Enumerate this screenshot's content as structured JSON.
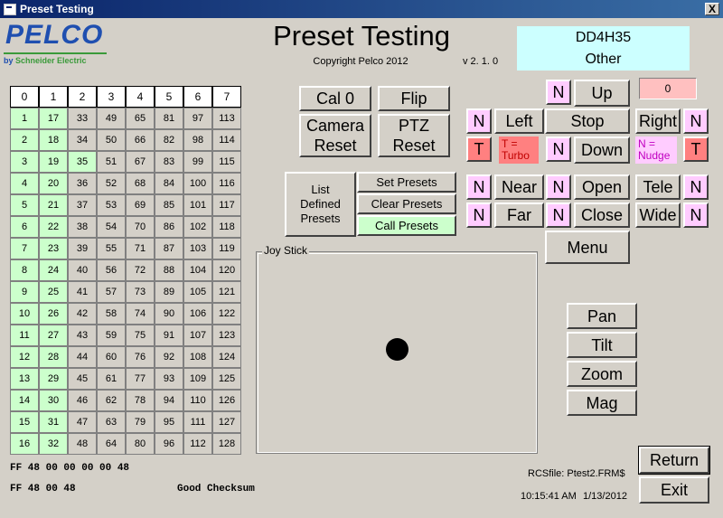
{
  "window": {
    "title": "Preset Testing",
    "close_glyph": "X"
  },
  "logo": {
    "brand": "PELCO",
    "by": "by ",
    "company": "Schneider Electric"
  },
  "header": {
    "title": "Preset Testing",
    "copyright": "Copyright Pelco 2012",
    "version": "v 2. 1. 0",
    "device_model": "DD4H35",
    "device_type": "Other"
  },
  "grid": {
    "headers": [
      "0",
      "1",
      "2",
      "3",
      "4",
      "5",
      "6",
      "7"
    ],
    "columns": [
      [
        "1",
        "2",
        "3",
        "4",
        "5",
        "6",
        "7",
        "8",
        "9",
        "10",
        "11",
        "12",
        "13",
        "14",
        "15",
        "16"
      ],
      [
        "17",
        "18",
        "19",
        "20",
        "21",
        "22",
        "23",
        "24",
        "25",
        "26",
        "27",
        "28",
        "29",
        "30",
        "31",
        "32"
      ],
      [
        "33",
        "34",
        "35",
        "36",
        "37",
        "38",
        "39",
        "40",
        "41",
        "42",
        "43",
        "44",
        "45",
        "46",
        "47",
        "48"
      ],
      [
        "49",
        "50",
        "51",
        "52",
        "53",
        "54",
        "55",
        "56",
        "57",
        "58",
        "59",
        "60",
        "61",
        "62",
        "63",
        "64"
      ],
      [
        "65",
        "66",
        "67",
        "68",
        "69",
        "70",
        "71",
        "72",
        "73",
        "74",
        "75",
        "76",
        "77",
        "78",
        "79",
        "80"
      ],
      [
        "81",
        "82",
        "83",
        "84",
        "85",
        "86",
        "87",
        "88",
        "89",
        "90",
        "91",
        "92",
        "93",
        "94",
        "95",
        "96"
      ],
      [
        "97",
        "98",
        "99",
        "100",
        "101",
        "102",
        "103",
        "104",
        "105",
        "106",
        "107",
        "108",
        "109",
        "110",
        "111",
        "112"
      ],
      [
        "113",
        "114",
        "115",
        "116",
        "117",
        "118",
        "119",
        "120",
        "121",
        "122",
        "123",
        "124",
        "125",
        "126",
        "127",
        "128"
      ]
    ],
    "highlighted": [
      "1",
      "2",
      "3",
      "4",
      "5",
      "6",
      "7",
      "8",
      "9",
      "10",
      "11",
      "12",
      "13",
      "14",
      "15",
      "16",
      "17",
      "18",
      "19",
      "20",
      "21",
      "22",
      "23",
      "24",
      "25",
      "26",
      "27",
      "28",
      "29",
      "30",
      "31",
      "32",
      "35"
    ],
    "highlight_color": "#ccffcc"
  },
  "commands": {
    "cal0": "Cal 0",
    "flip": "Flip",
    "camera_reset": "Camera Reset",
    "ptz_reset": "PTZ Reset",
    "list_presets": "List Defined Presets",
    "set_presets": "Set Presets",
    "clear_presets": "Clear Presets",
    "call_presets": "Call Presets"
  },
  "ptz": {
    "counter": "0",
    "up": "Up",
    "left": "Left",
    "stop": "Stop",
    "right": "Right",
    "down": "Down",
    "near": "Near",
    "open": "Open",
    "tele": "Tele",
    "far": "Far",
    "close": "Close",
    "wide": "Wide",
    "menu": "Menu",
    "n": "N",
    "t": "T",
    "turbo_label": "T = Turbo",
    "nudge_label": "N = Nudge"
  },
  "joystick": {
    "label": "Joy Stick"
  },
  "modes": {
    "pan": "Pan",
    "tilt": "Tilt",
    "zoom": "Zoom",
    "mag": "Mag"
  },
  "status": {
    "tx": "FF 48 00 00 00 00 48",
    "rx": "FF 48 00 48",
    "checksum": "Good Checksum",
    "rcsfile": "RCSfile: Ptest2.FRM$",
    "time": "10:15:41 AM",
    "date": "1/13/2012"
  },
  "actions": {
    "return": "Return",
    "exit": "Exit"
  },
  "colors": {
    "n_button": "#ffccff",
    "t_button": "#ff8080",
    "device_box": "#ccffff",
    "titlebar": "#0a246a"
  }
}
